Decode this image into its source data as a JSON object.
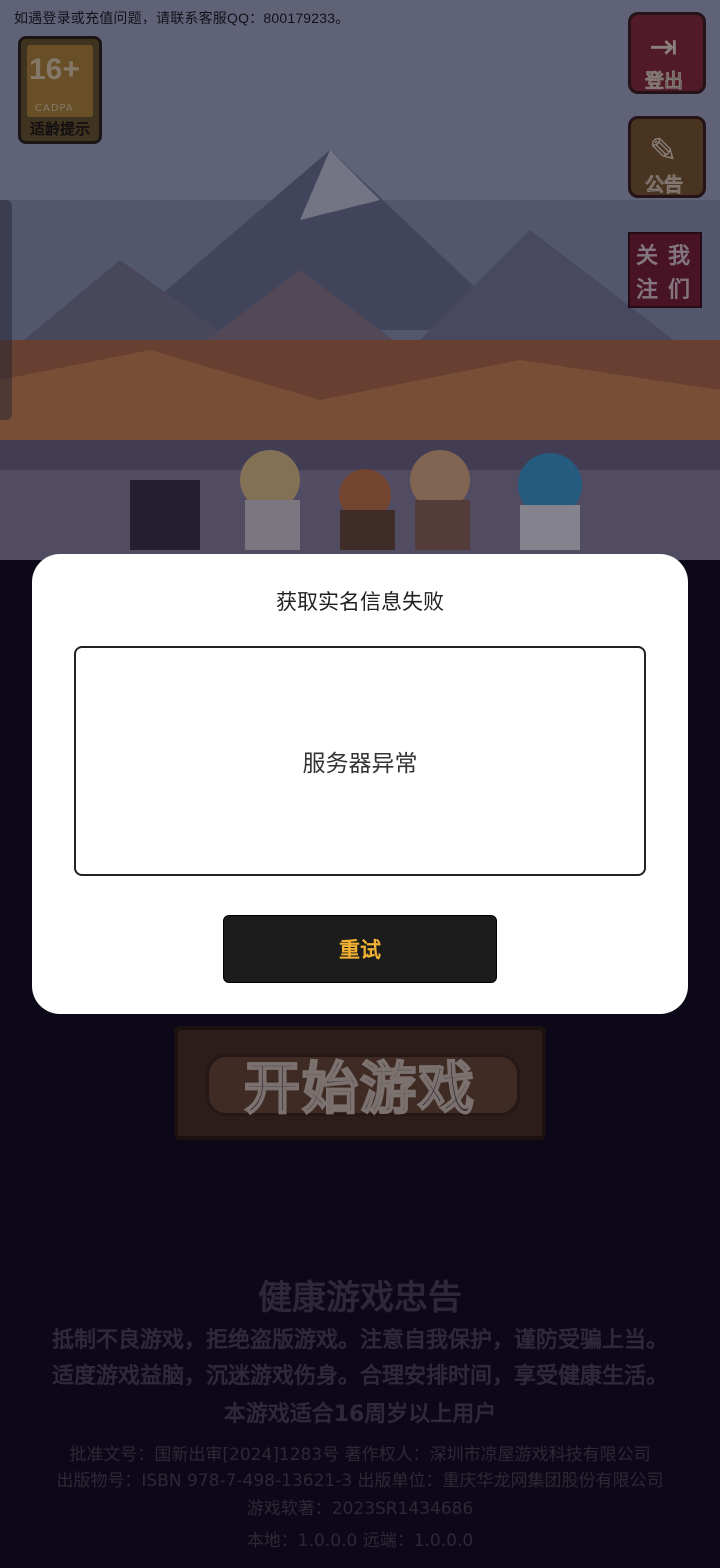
{
  "top_note": "如遇登录或充值问题，请联系客服QQ：800179233。",
  "age_badge": {
    "rating": "16+",
    "org": "CADPA",
    "label": "适龄提示"
  },
  "side_buttons": {
    "logout": "登出",
    "notice": "公告",
    "follow": [
      "关",
      "我",
      "注",
      "们"
    ]
  },
  "start_button": "开始游戏",
  "health": {
    "title": "健康游戏忠告",
    "line1": "抵制不良游戏，拒绝盗版游戏。注意自我保护，谨防受骗上当。",
    "line2": "适度游戏益脑，沉迷游戏伤身。合理安排时间，享受健康生活。",
    "line3": "本游戏适合16周岁以上用户",
    "small1": "批准文号：国新出审[2024]1283号 著作权人：深圳市凉屋游戏科技有限公司",
    "small2": "出版物号：ISBN 978-7-498-13621-3 出版单位：重庆华龙网集团股份有限公司",
    "small3": "游戏软著：2023SR1434686",
    "small4": "本地：1.0.0.0 远端：1.0.0.0"
  },
  "dialog": {
    "title": "获取实名信息失败",
    "message": "服务器异常",
    "retry": "重试"
  },
  "colors": {
    "retry_text": "#f2b233",
    "dialog_bg": "#ffffff",
    "overlay": "rgba(10,6,20,0.45)"
  }
}
